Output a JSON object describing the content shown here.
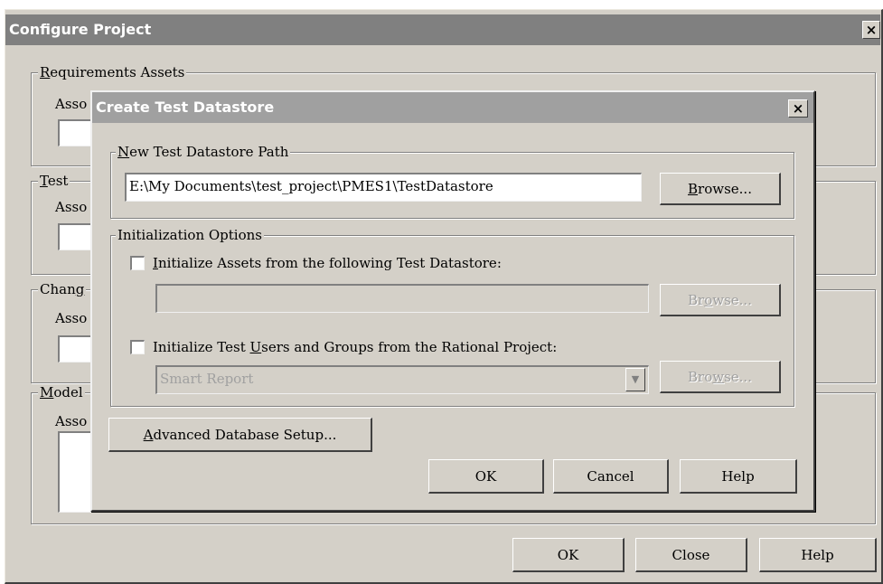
{
  "outer": {
    "title": "Configure Project",
    "close_glyph": "×",
    "groups": {
      "requirements": {
        "label_pre": "",
        "label_key": "R",
        "label_post": "equirements Assets",
        "assoc": "Asso"
      },
      "test": {
        "label_pre": "",
        "label_key": "T",
        "label_post": "est",
        "assoc": "Asso"
      },
      "change": {
        "label_pre": "Chan",
        "label_key": "g",
        "label_post": "",
        "assoc": "Asso"
      },
      "model": {
        "label_pre": "",
        "label_key": "M",
        "label_post": "odel",
        "assoc": "Asso"
      }
    },
    "buttons": {
      "ok": "OK",
      "close": "Close",
      "help": "Help"
    }
  },
  "dialog": {
    "title": "Create Test Datastore",
    "close_glyph": "×",
    "path_group": {
      "label_pre": "",
      "label_key": "N",
      "label_post": "ew Test Datastore Path",
      "value": "E:\\My Documents\\test_project\\PMES1\\TestDatastore",
      "browse_pre": "",
      "browse_key": "B",
      "browse_post": "rowse..."
    },
    "init_group": {
      "label": "Initialization Options",
      "opt1": {
        "pre": "",
        "key": "I",
        "post": "nitialize Assets from the following Test Datastore:",
        "checked": false
      },
      "browse1_pre": "Br",
      "browse1_key": "o",
      "browse1_post": "wse...",
      "opt2": {
        "pre": "Initialize Test ",
        "key": "U",
        "post": "sers and Groups from the Rational Project:",
        "checked": false
      },
      "dropdown_value": "Smart Report",
      "dropdown_icon": "chevron-down-icon",
      "browse2_pre": "Bro",
      "browse2_key": "w",
      "browse2_post": "se..."
    },
    "advanced_pre": "",
    "advanced_key": "A",
    "advanced_post": "dvanced Database Setup...",
    "buttons": {
      "ok": "OK",
      "cancel": "Cancel",
      "help": "Help"
    }
  }
}
